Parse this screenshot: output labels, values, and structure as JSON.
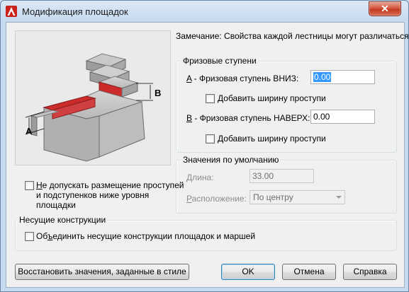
{
  "window": {
    "title": "Модификация площадок"
  },
  "note": "Замечание: Свойства каждой лестницы могут различаться.",
  "riser_group": {
    "title": "Фризовые ступени",
    "down": {
      "key": "A",
      "label": " - Фризовая ступень ВНИЗ:",
      "value": "0.00",
      "checkbox_label": "Добавить ширину проступи",
      "checkbox_key": "Д",
      "checkbox_rest": "обавить ширину проступи",
      "checked": false
    },
    "up": {
      "key": "B",
      "label": " - Фризовая ступень НАВЕРХ:",
      "value": "0.00",
      "checkbox_key": "Д",
      "checkbox_rest": "обавить ширину проступи",
      "checked": false
    }
  },
  "defaults_group": {
    "title": "Значения по умолчанию",
    "length_label": "Длина:",
    "length_value": "33.00",
    "position_key": "Р",
    "position_rest": "асположение:",
    "position_value": "По центру"
  },
  "illustration": {
    "label_a": "A",
    "label_b": "B"
  },
  "disallow": {
    "key": "Н",
    "line1_rest": "е допускать размещение проступей",
    "line2": "и подступенков ниже уровня",
    "line3": "площадки",
    "checked": false
  },
  "structure_group": {
    "title": "Несущие конструкции",
    "merge_before": "Об",
    "merge_key": "ъ",
    "merge_after": "единить несущие конструкции площадок и маршей",
    "checked": false
  },
  "buttons": {
    "restore": "Восстановить значения, заданные в стиле",
    "ok": "OK",
    "cancel": "Отмена",
    "help": "Справка"
  },
  "colors": {
    "accent_red": "#d4463a",
    "selection": "#3399ff"
  }
}
